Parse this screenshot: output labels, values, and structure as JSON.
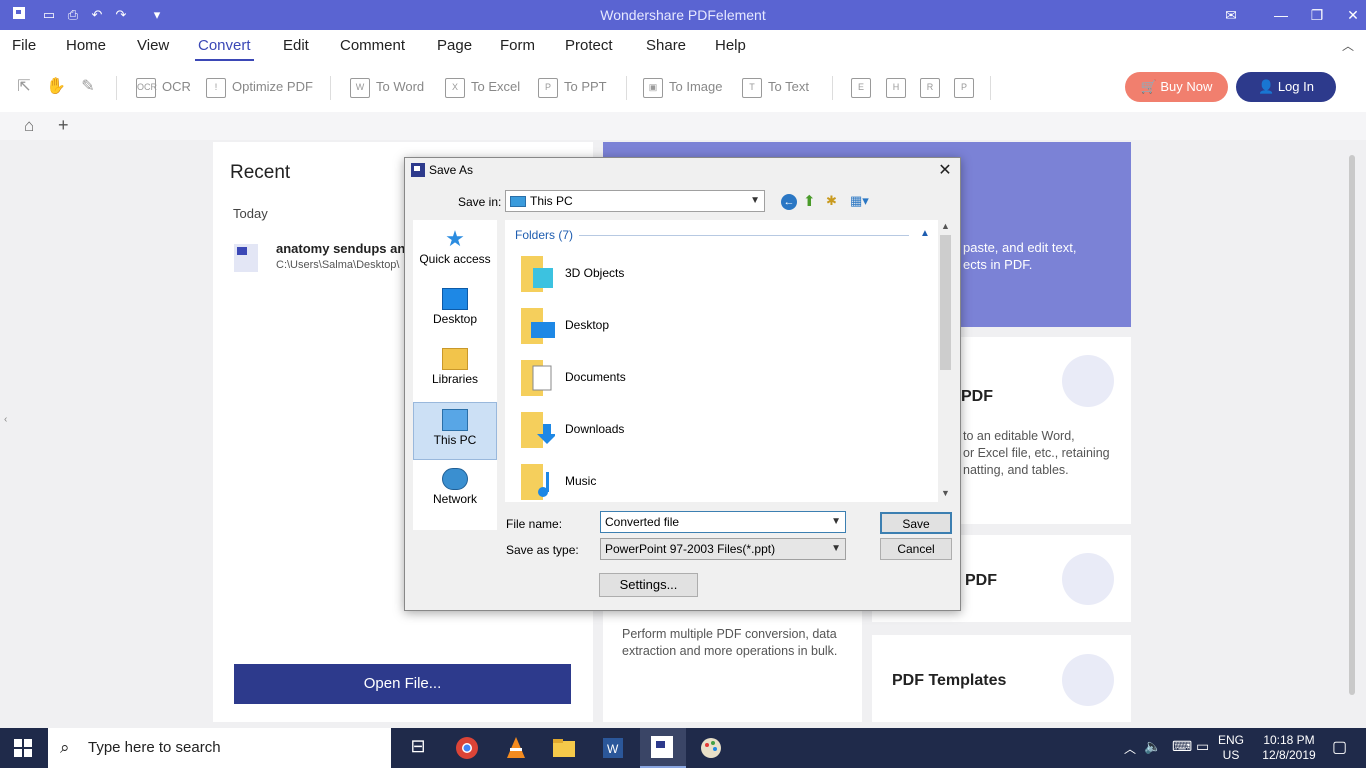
{
  "window": {
    "title": "Wondershare PDFelement"
  },
  "menu": [
    "File",
    "Home",
    "View",
    "Convert",
    "Edit",
    "Comment",
    "Page",
    "Form",
    "Protect",
    "Share",
    "Help"
  ],
  "menu_active": "Convert",
  "toolbar": {
    "ocr": "OCR",
    "optimize": "Optimize PDF",
    "to_word": "To Word",
    "to_excel": "To Excel",
    "to_ppt": "To PPT",
    "to_image": "To Image",
    "to_text": "To Text",
    "buy_now": "Buy Now",
    "log_in": "Log In"
  },
  "recent": {
    "title": "Recent",
    "today": "Today",
    "file_name": "anatomy sendups and",
    "file_path": "C:\\Users\\Salma\\Desktop\\",
    "open_button": "Open File..."
  },
  "banner": {
    "line1": "paste, and edit text,",
    "line2": "ects in PDF."
  },
  "cards": {
    "convert_title": "PDF",
    "convert_text1": "to an editable Word,",
    "convert_text2": "or Excel file, etc., retaining",
    "convert_text3": "natting, and tables.",
    "create_title": "PDF",
    "batch_text1": "Perform multiple PDF conversion, data",
    "batch_text2": "extraction and more operations in bulk.",
    "templates_title": "PDF Templates"
  },
  "dialog": {
    "title": "Save As",
    "save_in_label": "Save in:",
    "save_in_value": "This PC",
    "places": [
      "Quick access",
      "Desktop",
      "Libraries",
      "This PC",
      "Network"
    ],
    "selected_place": "This PC",
    "folders_header": "Folders (7)",
    "folders": [
      "3D Objects",
      "Desktop",
      "Documents",
      "Downloads",
      "Music"
    ],
    "file_name_label": "File name:",
    "file_name_value": "Converted file",
    "save_as_type_label": "Save as type:",
    "save_as_type_value": "PowerPoint 97-2003 Files(*.ppt)",
    "save_button": "Save",
    "cancel_button": "Cancel",
    "settings_button": "Settings..."
  },
  "taskbar": {
    "search_placeholder": "Type here to search",
    "lang1": "ENG",
    "lang2": "US",
    "time": "10:18 PM",
    "date": "12/8/2019"
  },
  "colors": {
    "titlebar": "#5a64d2",
    "accent": "#2d3a8c",
    "buy": "#f17f6e"
  }
}
